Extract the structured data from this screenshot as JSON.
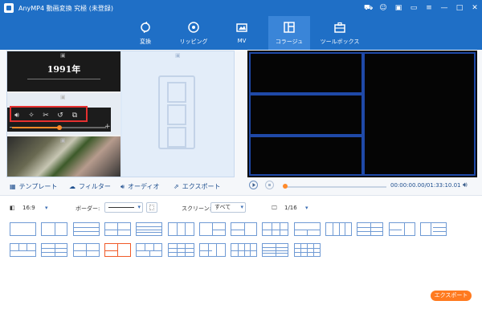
{
  "app": {
    "title": "AnyMP4 動画変換 究極 (未登録)"
  },
  "window_icons": [
    "cart-icon",
    "user-icon",
    "gift-icon",
    "feedback-icon",
    "menu-icon",
    "minimize-icon",
    "maximize-icon",
    "close-icon"
  ],
  "nav": {
    "tabs": [
      {
        "label": "変換",
        "icon": "convert-icon"
      },
      {
        "label": "リッピング",
        "icon": "ripper-icon"
      },
      {
        "label": "MV",
        "icon": "mv-icon"
      },
      {
        "label": "コラージュ",
        "icon": "collage-icon",
        "active": true
      },
      {
        "label": "ツールボックス",
        "icon": "toolbox-icon"
      }
    ]
  },
  "collage": {
    "video1_text": "1991年",
    "controls": [
      "volume-icon",
      "effect-icon",
      "cut-icon",
      "rotate-icon",
      "copy-icon"
    ],
    "volume_level": 0.5,
    "slider_minus": "−",
    "slider_plus": "+"
  },
  "playback": {
    "time": "00:00:00.00/01:33:10.01",
    "progress": 0.0
  },
  "subtabs": [
    {
      "label": "テンプレート",
      "icon": "template-icon",
      "active": true
    },
    {
      "label": "フィルター",
      "icon": "filter-icon"
    },
    {
      "label": "オーディオ",
      "icon": "audio-icon"
    },
    {
      "label": "エクスポート",
      "icon": "export-icon"
    }
  ],
  "options": {
    "aspect_ratio": "16:9",
    "border_label": "ボーダー:",
    "screen_label": "スクリーン:",
    "screen_value": "すべて",
    "page": "1/16"
  },
  "templates": {
    "count": 30,
    "selected_index": 17
  },
  "export_button": "エクスポート",
  "colors": {
    "brand": "#1f6fc6",
    "accent": "#ff7a1f",
    "selected_template": "#f05a28",
    "template": "#6f9ad4"
  }
}
